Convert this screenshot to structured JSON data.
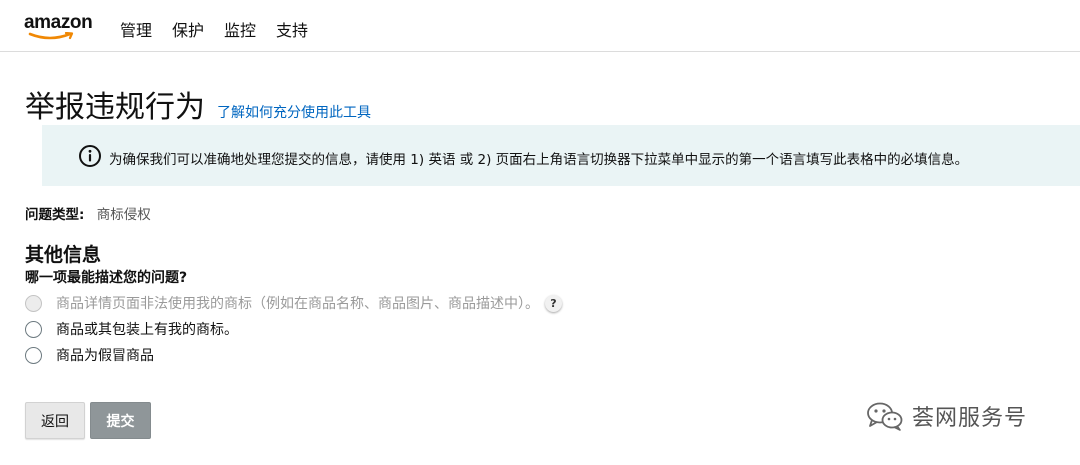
{
  "header": {
    "logo_text": "amazon",
    "nav": [
      "管理",
      "保护",
      "监控",
      "支持"
    ]
  },
  "page": {
    "title": "举报违规行为",
    "help_link": "了解如何充分使用此工具"
  },
  "info_alert": {
    "icon": "info-icon",
    "text": "为确保我们可以准确地处理您提交的信息，请使用 1) 英语 或 2) 页面右上角语言切换器下拉菜单中显示的第一个语言填写此表格中的必填信息。"
  },
  "issue_type": {
    "label": "问题类型:",
    "value": "商标侵权"
  },
  "section": {
    "title": "其他信息",
    "question": "哪一项最能描述您的问题?"
  },
  "options": [
    {
      "label": "商品详情页面非法使用我的商标（例如在商品名称、商品图片、商品描述中）。",
      "disabled": true,
      "has_help": true
    },
    {
      "label": "商品或其包装上有我的商标。",
      "disabled": false,
      "has_help": false
    },
    {
      "label": "商品为假冒商品",
      "disabled": false,
      "has_help": false
    }
  ],
  "help_icon_text": "?",
  "buttons": {
    "back": "返回",
    "submit": "提交"
  },
  "watermark": {
    "icon": "wechat-icon",
    "text": "荟网服务号"
  },
  "colors": {
    "link": "#0066c0",
    "alert_background": "#eaf4f5",
    "submit_button": "#8f9699",
    "back_button": "#e8e8e8"
  }
}
